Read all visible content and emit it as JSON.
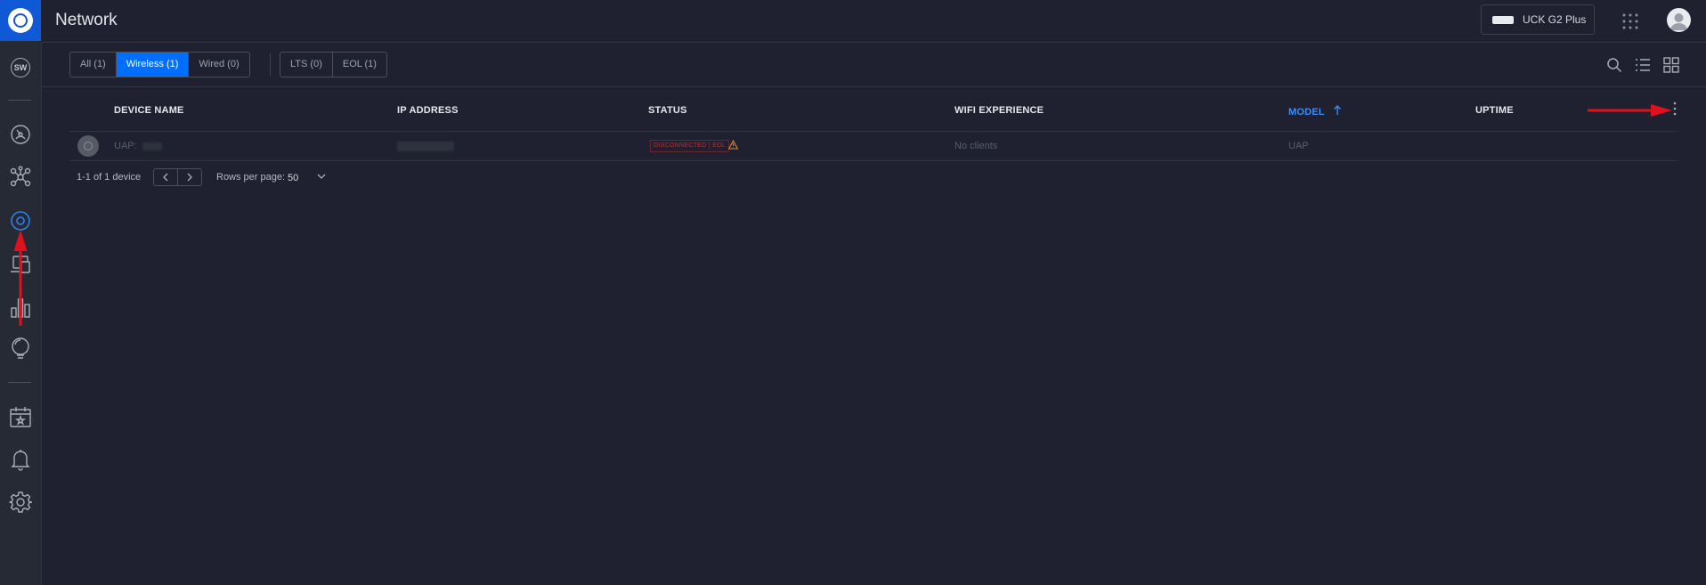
{
  "app": {
    "title": "Network"
  },
  "header": {
    "device_name": "UCK G2 Plus"
  },
  "sidebar": {
    "badge": "SW",
    "items": [
      {
        "name": "dashboard"
      },
      {
        "name": "topology"
      },
      {
        "name": "devices",
        "active": true
      },
      {
        "name": "clients"
      },
      {
        "name": "statistics"
      },
      {
        "name": "insights"
      },
      {
        "name": "events"
      },
      {
        "name": "alerts"
      },
      {
        "name": "settings"
      }
    ]
  },
  "filters": {
    "type": [
      {
        "label": "All (1)",
        "active": false
      },
      {
        "label": "Wireless (1)",
        "active": true
      },
      {
        "label": "Wired (0)",
        "active": false
      }
    ],
    "lifecycle": [
      {
        "label": "LTS (0)",
        "active": false
      },
      {
        "label": "EOL (1)",
        "active": false
      }
    ]
  },
  "table": {
    "columns": {
      "device_name": "DEVICE NAME",
      "ip_address": "IP ADDRESS",
      "status": "STATUS",
      "wifi_experience": "WIFI EXPERIENCE",
      "model": "MODEL",
      "uptime": "UPTIME"
    },
    "sort": {
      "column": "model",
      "direction": "ascending"
    },
    "rows": [
      {
        "device_name": "UAP:",
        "ip_address": "",
        "status": "DISCONNECTED | EOL",
        "wifi_experience": "No clients",
        "model": "UAP",
        "uptime": ""
      }
    ]
  },
  "pagination": {
    "summary": "1-1 of 1 device",
    "rows_per_page_label": "Rows per page:",
    "rows_per_page": "50"
  },
  "colors": {
    "accent": "#006fff",
    "sidebar_active": "#2f7ff0",
    "status_error": "#b4303b",
    "warning": "#d98a2b",
    "annotation": "#e0101d"
  }
}
